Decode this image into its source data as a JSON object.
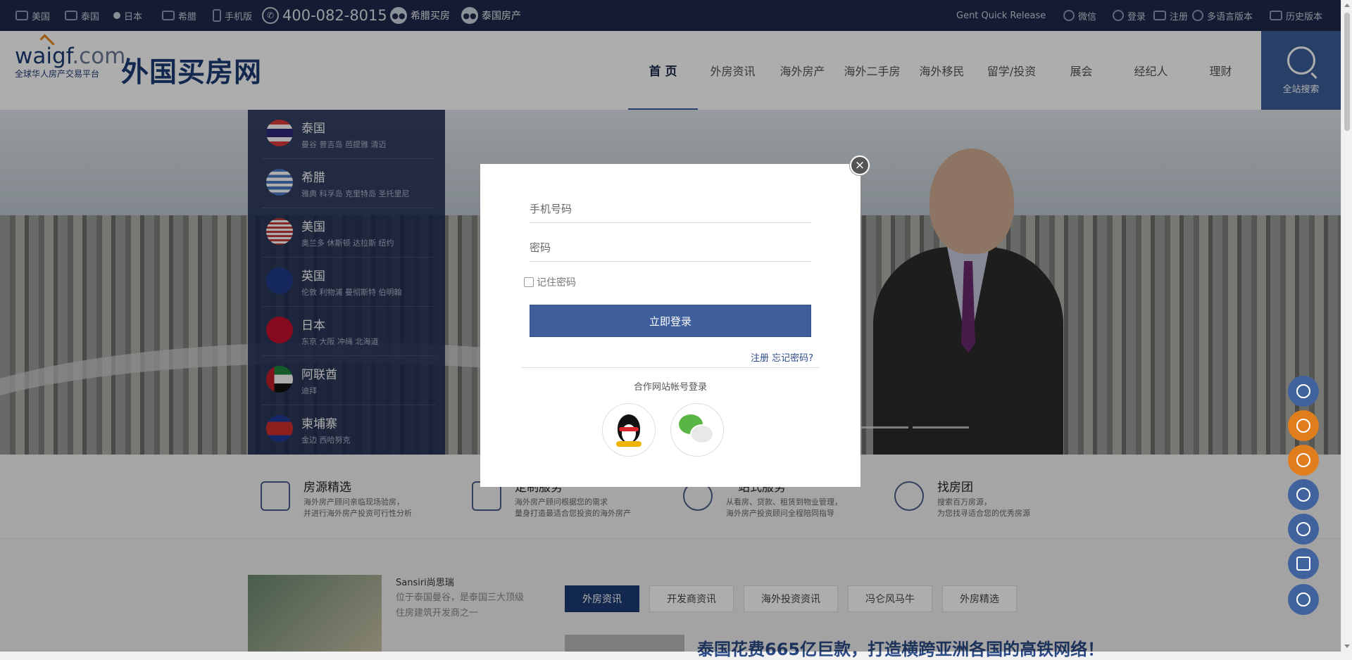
{
  "topbar": {
    "left_links": [
      "美国",
      "泰国",
      "日本",
      "希腊",
      "手机版"
    ],
    "phone": "400-082-8015",
    "wechat_links": [
      "希腊买房",
      "泰国房产"
    ],
    "release_label": "Gent Quick Release",
    "right_links": [
      "微信",
      "登录",
      "注册",
      "多语言版本",
      "历史版本"
    ]
  },
  "header": {
    "logo_en": "waigf",
    "logo_com": ".com",
    "logo_sub": "全球华人房产交易平台",
    "logo_cn": "外国买房网",
    "nav": [
      "首 页",
      "外房资讯",
      "海外房产",
      "海外二手房",
      "海外移民",
      "留学/投资",
      "展会",
      "经纪人",
      "理财"
    ],
    "search_label": "全站搜索"
  },
  "countries": [
    {
      "name": "泰国",
      "cities": "曼谷  普吉岛  芭提雅  清迈",
      "flag": "flag-th"
    },
    {
      "name": "希腊",
      "cities": "雅典  科孚岛  克里特岛  圣托里尼",
      "flag": "flag-gr"
    },
    {
      "name": "美国",
      "cities": "奥兰多  休斯顿  达拉斯  纽约",
      "flag": "flag-us"
    },
    {
      "name": "英国",
      "cities": "伦敦  利物浦  曼彻斯特  伯明翰",
      "flag": "flag-uk"
    },
    {
      "name": "日本",
      "cities": "东京  大阪  冲绳  北海道",
      "flag": "flag-jp"
    },
    {
      "name": "阿联酋",
      "cities": "迪拜",
      "flag": "flag-ae"
    },
    {
      "name": "柬埔寨",
      "cities": "金边  西哈努克",
      "flag": "flag-kh"
    }
  ],
  "services": [
    {
      "title": "房源精选",
      "desc1": "海外房产顾问亲临现场验房，",
      "desc2": "并进行海外房产投资可行性分析"
    },
    {
      "title": "定制服务",
      "desc1": "海外房产顾问根据您的需求",
      "desc2": "量身打造最适合您投资的海外房产"
    },
    {
      "title": "一站式服务",
      "desc1": "从看房、贷款、租赁到物业管理，",
      "desc2": "海外房产投资顾问全程陪同指导"
    },
    {
      "title": "找房团",
      "desc1": "搜索百万房源，",
      "desc2": "为您找寻适合您的优秀房源"
    }
  ],
  "promo": {
    "title": "Sansiri尚思瑞",
    "desc": "位于泰国曼谷，是泰国三大顶级住房建筑开发商之一"
  },
  "news": {
    "tabs": [
      "外房资讯",
      "开发商资讯",
      "海外投资资讯",
      "冯仑风马牛",
      "外房精选"
    ],
    "headline": "泰国花费665亿巨款，打造横跨亚洲各国的高铁网络！"
  },
  "login_modal": {
    "phone_placeholder": "手机号码",
    "password_placeholder": "密码",
    "remember_label": "记住密码",
    "login_button": "立即登录",
    "register_link": "注册",
    "forgot_link": "忘记密码?",
    "partner_label": "合作网站帐号登录",
    "close_symbol": "×"
  }
}
